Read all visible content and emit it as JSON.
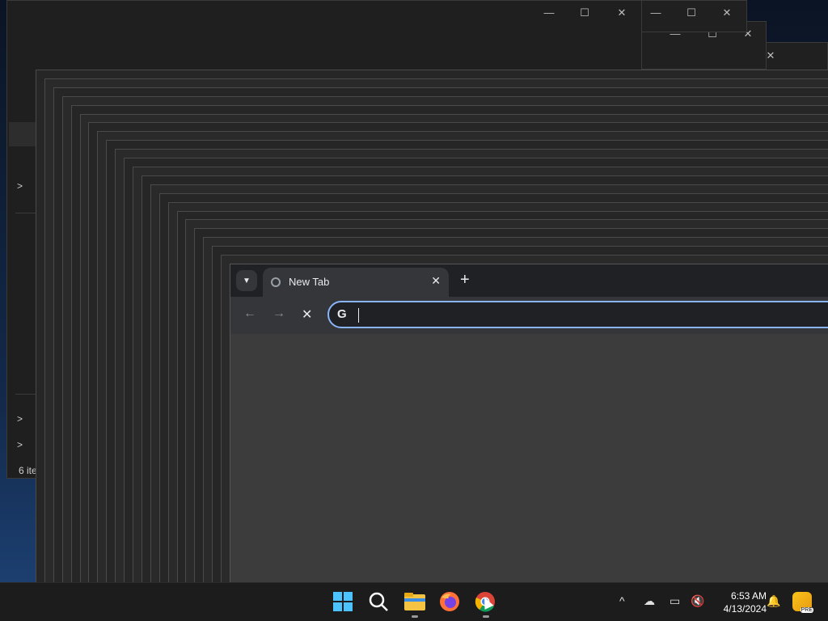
{
  "explorer": {
    "status_text": "6 ite",
    "chevrons": [
      ">",
      ">",
      ">"
    ]
  },
  "background_windows": {
    "window1_controls": [
      "—",
      "☐",
      "✕"
    ],
    "window2_controls": [
      "—",
      "☐",
      "✕"
    ],
    "window3_controls": [
      "—",
      "☐",
      "✕"
    ]
  },
  "browser": {
    "tab_title": "New Tab",
    "tab_close": "✕",
    "new_tab": "+",
    "back": "←",
    "forward": "→",
    "stop": "✕",
    "omnibox_icon": "G",
    "omnibox_value": "",
    "accent_color": "#8ab4f8"
  },
  "taskbar": {
    "apps": [
      "start-icon",
      "search-icon",
      "file-explorer-icon",
      "firefox-icon",
      "chrome-icon"
    ],
    "tray": {
      "show_hidden": "^",
      "time": "6:53 AM",
      "date": "4/13/2024"
    }
  }
}
